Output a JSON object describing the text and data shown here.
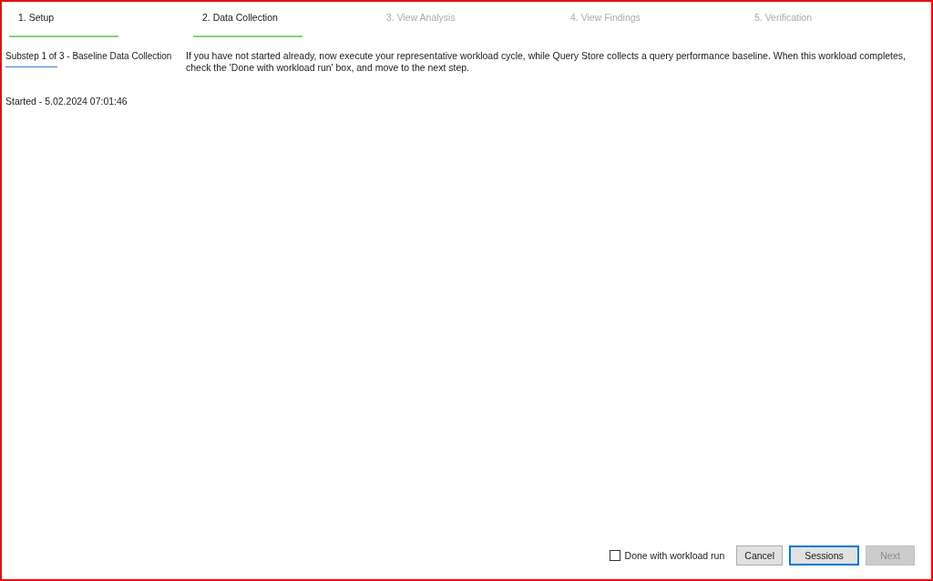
{
  "steps": [
    {
      "label": "1. Setup",
      "disabled": false
    },
    {
      "label": "2. Data Collection",
      "disabled": false
    },
    {
      "label": "3. View Analysis",
      "disabled": true
    },
    {
      "label": "4. View Findings",
      "disabled": true
    },
    {
      "label": "5. Verification",
      "disabled": true
    }
  ],
  "substep": {
    "label": "Substep 1 of 3 - Baseline Data Collection",
    "instructions": "If you have not started already, now execute your representative workload cycle, while Query Store collects a query performance baseline. When this workload completes, check the 'Done with workload run' box, and move to the next step."
  },
  "started": "Started - 5.02.2024 07:01:46",
  "done_checkbox": {
    "label": "Done with workload run",
    "checked": false
  },
  "buttons": [
    {
      "label": "Cancel",
      "disabled": false,
      "focused": false
    },
    {
      "label": "Sessions",
      "disabled": false,
      "focused": true
    },
    {
      "label": "Next",
      "disabled": true,
      "focused": false
    }
  ]
}
